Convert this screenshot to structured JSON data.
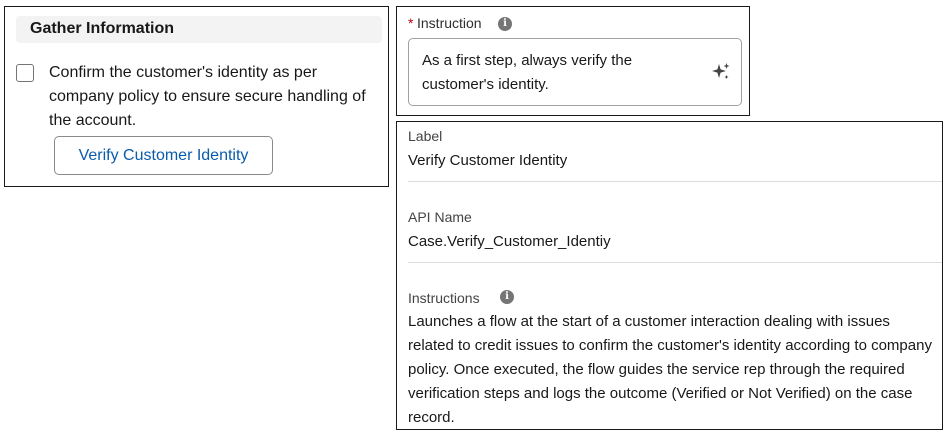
{
  "gather": {
    "title": "Gather Information",
    "task_text": "Confirm the customer's identity as per company policy to ensure secure handling of the account.",
    "button_label": "Verify Customer Identity"
  },
  "instruction": {
    "label": "Instruction",
    "required_marker": "*",
    "value": "As a first step, always verify the customer's identity.",
    "info_icon": "info-icon",
    "action_icon": "sparkle-icon"
  },
  "properties": {
    "label_title": "Label",
    "label_value": "Verify Customer Identity",
    "api_title": "API Name",
    "api_value": "Case.Verify_Customer_Identiy",
    "instructions_title": "Instructions",
    "instructions_value": "Launches a flow at the start of a customer interaction dealing with issues related to credit issues to confirm the customer's identity according to company policy. Once executed, the flow guides the service rep through the required verification steps and logs the outcome (Verified or Not Verified) on the case record."
  },
  "colors": {
    "link_blue": "#0b5cab",
    "required_red": "#ba0517",
    "header_gray": "#f3f3f3",
    "icon_gray": "#757575"
  }
}
